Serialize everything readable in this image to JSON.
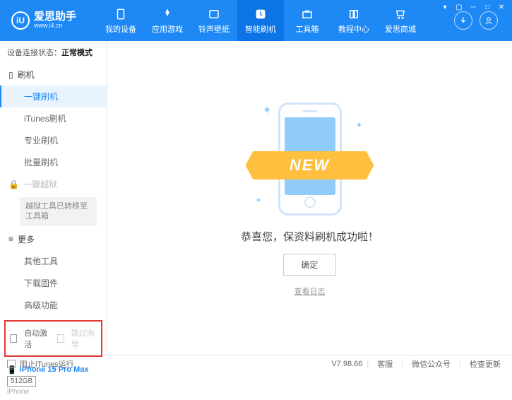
{
  "header": {
    "logo_symbol": "iU",
    "title": "爱思助手",
    "subtitle": "www.i4.cn",
    "nav": [
      {
        "label": "我的设备"
      },
      {
        "label": "应用游戏"
      },
      {
        "label": "铃声壁纸"
      },
      {
        "label": "智能刷机"
      },
      {
        "label": "工具箱"
      },
      {
        "label": "教程中心"
      },
      {
        "label": "爱思商城"
      }
    ]
  },
  "sidebar": {
    "status_label": "设备连接状态：",
    "status_value": "正常模式",
    "flash_header": "刷机",
    "items": {
      "one_key": "一键刷机",
      "itunes": "iTunes刷机",
      "pro": "专业刷机",
      "batch": "批量刷机"
    },
    "jailbreak_header": "一键越狱",
    "jailbreak_note": "越狱工具已转移至工具箱",
    "more_header": "更多",
    "more": {
      "other": "其他工具",
      "download": "下载固件",
      "advanced": "高级功能"
    },
    "checkboxes": {
      "auto_activate": "自动激活",
      "skip_guide": "跳过向导"
    },
    "device": {
      "name": "iPhone 15 Pro Max",
      "storage": "512GB",
      "type": "iPhone"
    }
  },
  "main": {
    "ribbon": "NEW",
    "success": "恭喜您，保资料刷机成功啦！",
    "ok": "确定",
    "view_log": "查看日志"
  },
  "footer": {
    "block_itunes": "阻止iTunes运行",
    "version": "V7.98.66",
    "service": "客服",
    "wechat": "微信公众号",
    "check_update": "检查更新"
  }
}
